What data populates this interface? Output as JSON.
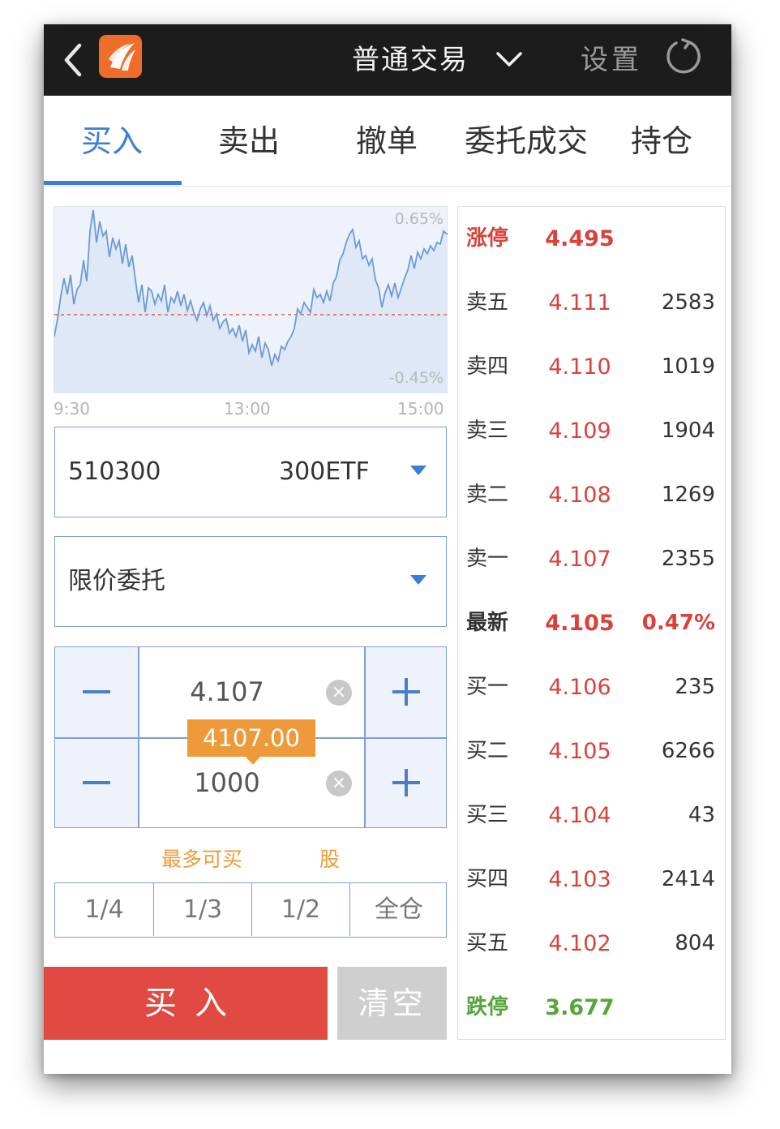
{
  "header": {
    "title": "普通交易",
    "settings_label": "设置"
  },
  "tabs": [
    "买入",
    "卖出",
    "撤单",
    "委托成交",
    "持仓"
  ],
  "chart": {
    "pct_top": "0.65%",
    "pct_bottom": "-0.45%",
    "time_labels": [
      "9:30",
      "13:00",
      "15:00"
    ]
  },
  "security": {
    "code": "510300",
    "name": "300ETF"
  },
  "order_type": "限价委托",
  "price_input": {
    "value": "4.107"
  },
  "qty_input": {
    "value": "1000"
  },
  "amount_tooltip": "4107.00",
  "max_buy": {
    "label": "最多可买",
    "unit": "股"
  },
  "fractions": [
    "1/4",
    "1/3",
    "1/2",
    "全仓"
  ],
  "actions": {
    "buy": "买入",
    "clear": "清空"
  },
  "order_book": {
    "limit_up": {
      "label": "涨停",
      "price": "4.495"
    },
    "asks": [
      {
        "label": "卖五",
        "price": "4.111",
        "vol": "2583"
      },
      {
        "label": "卖四",
        "price": "4.110",
        "vol": "1019"
      },
      {
        "label": "卖三",
        "price": "4.109",
        "vol": "1904"
      },
      {
        "label": "卖二",
        "price": "4.108",
        "vol": "1269"
      },
      {
        "label": "卖一",
        "price": "4.107",
        "vol": "2355"
      }
    ],
    "latest": {
      "label": "最新",
      "price": "4.105",
      "change": "0.47%"
    },
    "bids": [
      {
        "label": "买一",
        "price": "4.106",
        "vol": "235"
      },
      {
        "label": "买二",
        "price": "4.105",
        "vol": "6266"
      },
      {
        "label": "买三",
        "price": "4.104",
        "vol": "43"
      },
      {
        "label": "买四",
        "price": "4.103",
        "vol": "2414"
      },
      {
        "label": "买五",
        "price": "4.102",
        "vol": "804"
      }
    ],
    "limit_down": {
      "label": "跌停",
      "price": "3.677"
    }
  },
  "colors": {
    "accent": "#3b7fd4",
    "up": "#d9423a",
    "down": "#55a53a",
    "buy": "#e04a42",
    "tooltip": "#ee9a3a"
  }
}
